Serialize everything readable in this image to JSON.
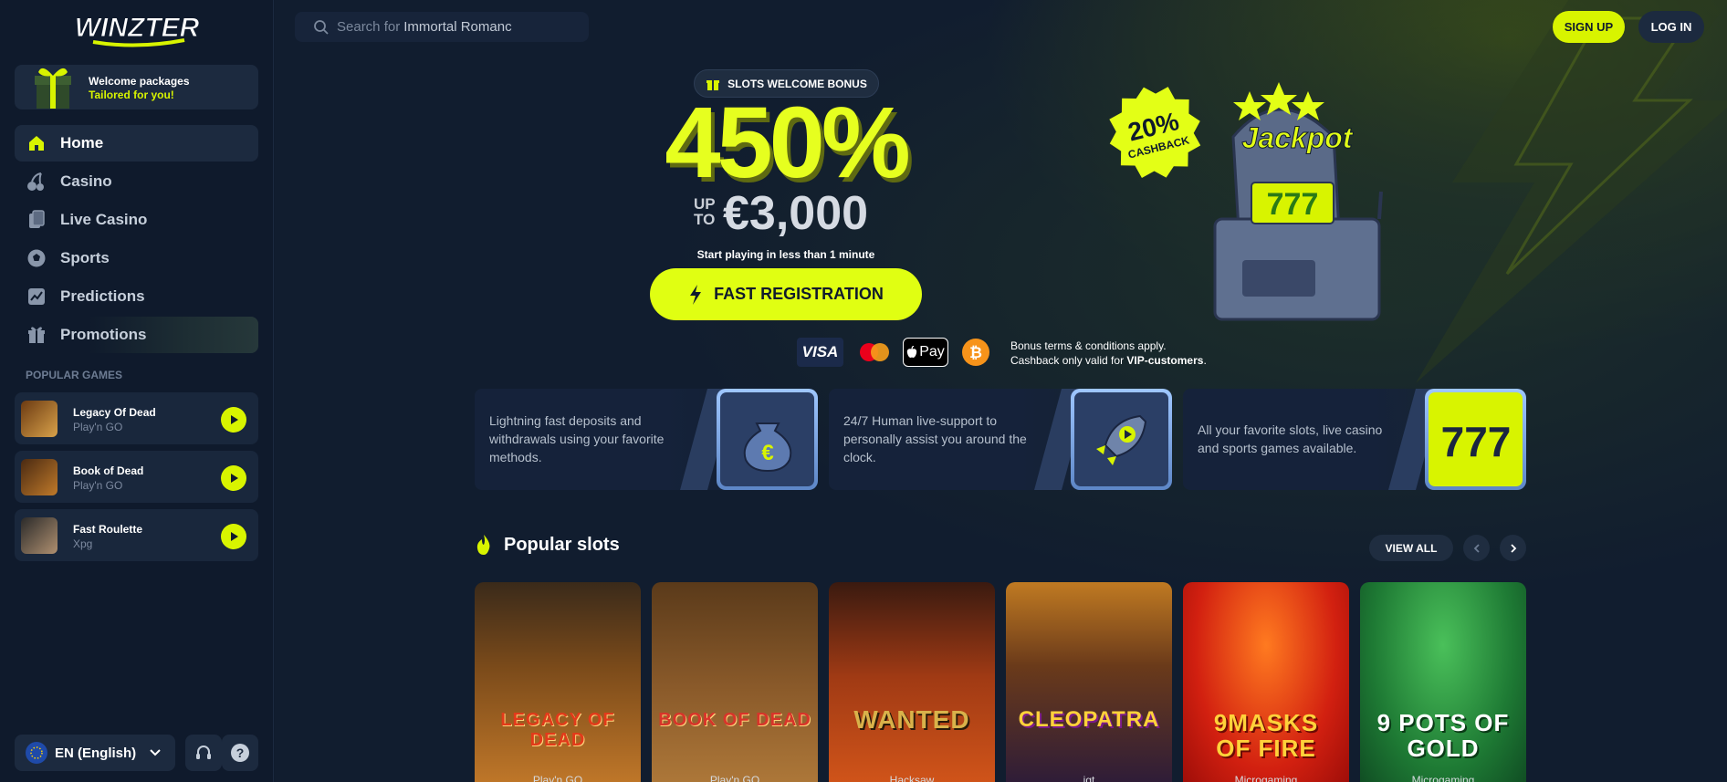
{
  "brand": {
    "logo_text": "WINZTER",
    "accent": "#d8f400",
    "bg": "#101c2e"
  },
  "sidebar": {
    "welcome": {
      "line1": "Welcome packages",
      "line2": "Tailored for you!"
    },
    "nav": [
      {
        "label": "Home",
        "icon": "home-icon",
        "active": true
      },
      {
        "label": "Casino",
        "icon": "cherries-icon"
      },
      {
        "label": "Live Casino",
        "icon": "cards-icon"
      },
      {
        "label": "Sports",
        "icon": "soccer-ball-icon"
      },
      {
        "label": "Predictions",
        "icon": "trend-chart-icon"
      },
      {
        "label": "Promotions",
        "icon": "gift-icon"
      }
    ],
    "popular_title": "POPULAR GAMES",
    "popular": [
      {
        "name": "Legacy Of Dead",
        "provider": "Play'n GO"
      },
      {
        "name": "Book of Dead",
        "provider": "Play'n GO"
      },
      {
        "name": "Fast Roulette",
        "provider": "Xpg"
      }
    ],
    "language": "EN (English)"
  },
  "header": {
    "search_placeholder": "Search for",
    "search_value": "Immortal Romanc",
    "signup": "SIGN UP",
    "login": "LOG IN"
  },
  "hero": {
    "pill": "SLOTS WELCOME BONUS",
    "percent": "450%",
    "up": "UP",
    "to": "TO",
    "amount": "€3,000",
    "subline": "Start playing in less than 1 minute",
    "cta": "FAST REGISTRATION",
    "payments": [
      "VISA",
      "Mastercard",
      "Pay",
      "Bitcoin"
    ],
    "terms_line1": "Bonus terms & conditions apply.",
    "terms_line2_a": "Cashback only valid for ",
    "terms_line2_b": "VIP-customers",
    "terms_line2_c": ".",
    "cashback_top": "20%",
    "cashback_bottom": "CASHBACK",
    "jackpot": "Jackpot",
    "reels": "777"
  },
  "features": [
    {
      "text": "Lightning fast deposits and withdrawals using your favorite methods.",
      "icon": "money-bag-icon"
    },
    {
      "text": "24/7 Human live-support to personally assist you around the clock.",
      "icon": "rocket-play-icon"
    },
    {
      "text": "All your favorite slots, live casino and sports games available.",
      "icon": "seven-seven-seven-icon"
    }
  ],
  "popular_slots": {
    "title": "Popular slots",
    "view_all": "VIEW ALL",
    "games": [
      {
        "title": "LEGACY OF DEAD",
        "provider": "Play'n GO",
        "colors": [
          "#4a2a12",
          "#b8752a"
        ],
        "text_color": "#e23a1a"
      },
      {
        "title": "BOOK OF DEAD",
        "provider": "Play'n GO",
        "colors": [
          "#3b2210",
          "#a46a2f"
        ],
        "text_color": "#d8342a"
      },
      {
        "title": "WANTED",
        "provider": "Hacksaw",
        "colors": [
          "#5a1a10",
          "#c4461a"
        ],
        "text_color": "#d9b24a"
      },
      {
        "title": "CLEOPATRA",
        "provider": "igt",
        "colors": [
          "#2a1a3a",
          "#c07a22"
        ],
        "text_color": "#ffd23a"
      },
      {
        "title": "9MASKS OF FIRE",
        "provider": "Microgaming",
        "colors": [
          "#b8140c",
          "#f04a10"
        ],
        "text_color": "#ffd23a"
      },
      {
        "title": "9 POTS OF GOLD",
        "provider": "Microgaming",
        "colors": [
          "#0f4a22",
          "#2ea04a"
        ],
        "text_color": "#ffffff"
      }
    ]
  }
}
